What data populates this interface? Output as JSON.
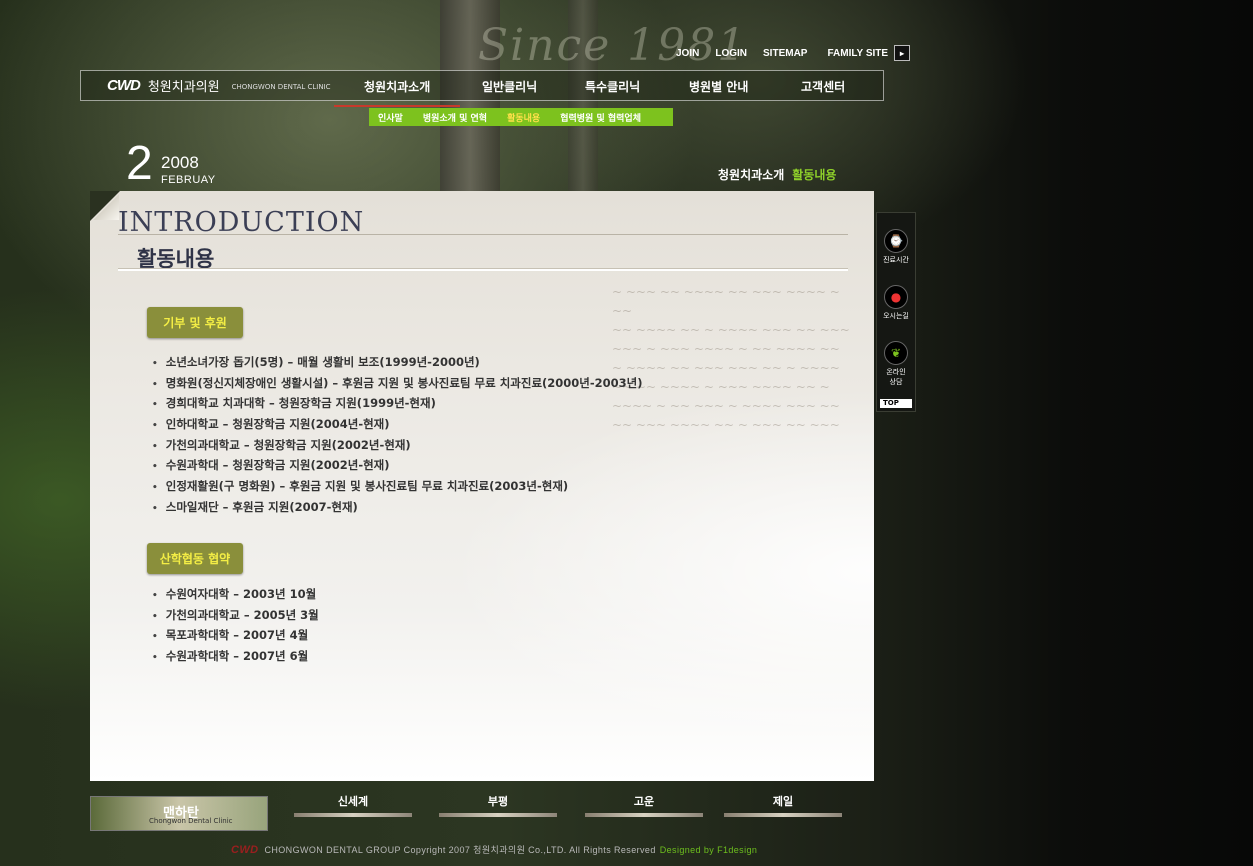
{
  "background_text": "Since 1981",
  "top_links": {
    "join": "JOIN",
    "login": "LOGIN",
    "sitemap": "SITEMAP",
    "family_site": "FAMILY SITE",
    "arrow": "▸"
  },
  "logo": {
    "mark": "CWD",
    "name_ko": "청원치과의원",
    "name_en": "CHONGWON DENTAL CLINIC"
  },
  "nav": [
    "청원치과소개",
    "일반클리닉",
    "특수클리닉",
    "병원별 안내",
    "고객센터"
  ],
  "submenu": [
    "인사말",
    "병원소개 및 연혁",
    "활동내용",
    "협력병원 및 협력업체"
  ],
  "date": {
    "day": "2",
    "year": "2008",
    "month": "FEBRUAY"
  },
  "breadcrumb": {
    "section": "청원치과소개",
    "current": "활동내용"
  },
  "content": {
    "heading_en": "INTRODUCTION",
    "title": "활동내용",
    "sections": [
      {
        "tag": "기부 및 후원",
        "items": [
          "소년소녀가장 돕기(5명) – 매월 생활비 보조(1999년-2000년)",
          "명화원(정신지체장애인 생활시설) – 후원금 지원 및 봉사진료팀 무료 치과진료(2000년-2003년)",
          "경희대학교 치과대학 – 청원장학금 지원(1999년-현재)",
          "인하대학교 – 청원장학금 지원(2004년-현재)",
          "가천의과대학교 – 청원장학금 지원(2002년-현재)",
          "수원과학대 – 청원장학금 지원(2002년-현재)",
          "인정재활원(구 명화원) – 후원금 지원 및 봉사진료팀 무료 치과진료(2003년-현재)",
          "스마일재단 – 후원금 지원(2007-현재)"
        ]
      },
      {
        "tag": "산학협동 협약",
        "items": [
          "수원여자대학 – 2003년 10월",
          "가천의과대학교 – 2005년 3월",
          "목포과학대학 – 2007년 4월",
          "수원과학대학 – 2007년 6월"
        ]
      }
    ]
  },
  "quick_menu": {
    "hours": "진료시간",
    "directions": "오시는길",
    "consult_1": "온라인",
    "consult_2": "상담",
    "top": "TOP"
  },
  "branches": {
    "main": "맨하탄",
    "main_sub": "Chongwon Dental Clinic",
    "list": [
      "신세계",
      "부평",
      "고운",
      "제일"
    ]
  },
  "footer": {
    "mark": "CWD",
    "copyright": "CHONGWON DENTAL GROUP Copyright 2007 청원치과의원 Co.,LTD. All Rights Reserved",
    "designer": "Designed by F1design"
  }
}
